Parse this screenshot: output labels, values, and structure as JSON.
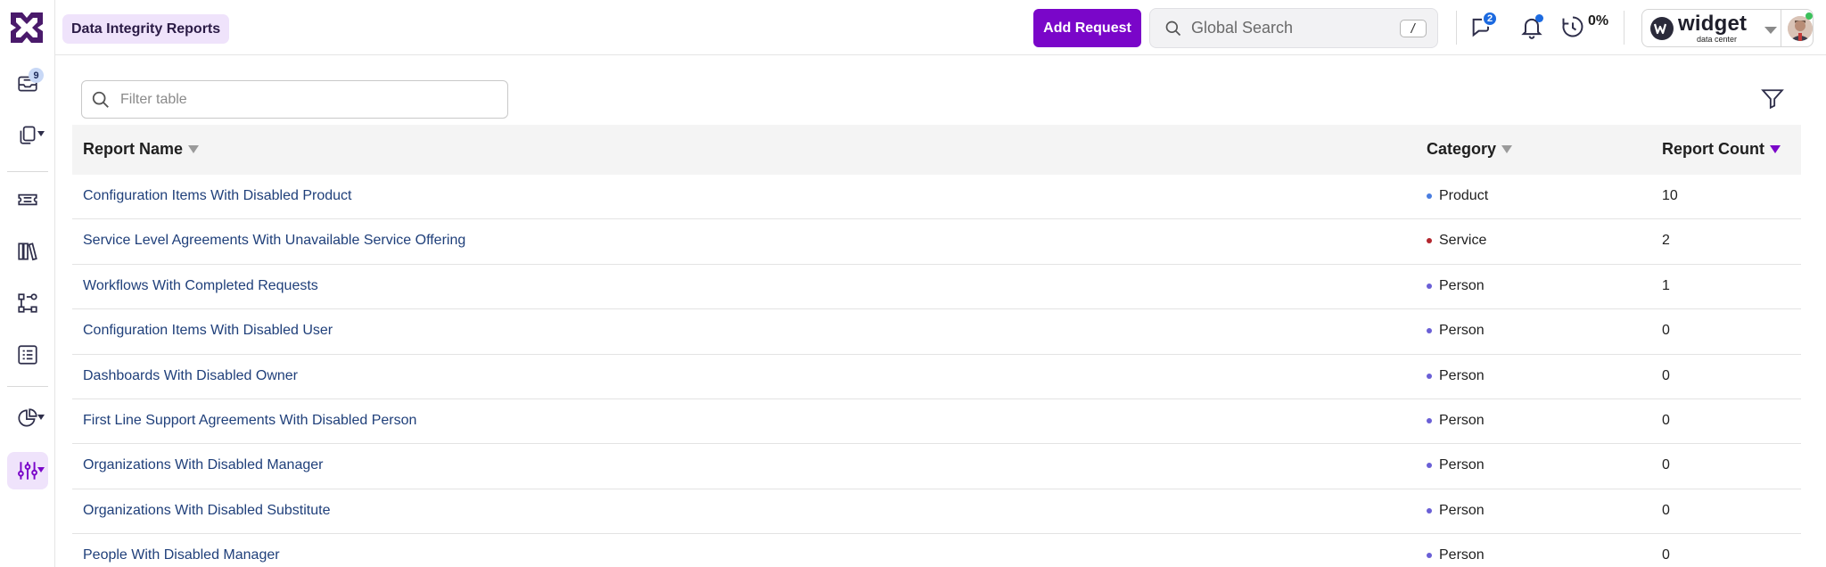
{
  "app": {
    "breadcrumb": "Data Integrity Reports"
  },
  "sidebar": {
    "inbox_badge": "9",
    "items": [
      {
        "name": "inbox-icon"
      },
      {
        "name": "copies-icon"
      },
      {
        "name": "ticket-icon"
      },
      {
        "name": "library-icon"
      },
      {
        "name": "workflow-icon"
      },
      {
        "name": "list-icon"
      },
      {
        "name": "analytics-icon"
      },
      {
        "name": "settings-sliders-icon"
      }
    ]
  },
  "header": {
    "add_request_label": "Add Request",
    "search_placeholder": "Global Search",
    "search_shortcut": "/",
    "chat_badge": "2",
    "timer_percent": "0%",
    "account": {
      "brand": "widget",
      "brand_sub": "data center"
    }
  },
  "main": {
    "filter_placeholder": "Filter table",
    "columns": {
      "name": "Report Name",
      "category": "Category",
      "count": "Report Count"
    },
    "rows": [
      {
        "name": "Configuration Items With Disabled Product",
        "category": "Product",
        "dot": "#4a7de0",
        "count": "10"
      },
      {
        "name": "Service Level Agreements With Unavailable Service Offering",
        "category": "Service",
        "dot": "#b3262e",
        "count": "2"
      },
      {
        "name": "Workflows With Completed Requests",
        "category": "Person",
        "dot": "#6a5fd6",
        "count": "1"
      },
      {
        "name": "Configuration Items With Disabled User",
        "category": "Person",
        "dot": "#6a5fd6",
        "count": "0"
      },
      {
        "name": "Dashboards With Disabled Owner",
        "category": "Person",
        "dot": "#6a5fd6",
        "count": "0"
      },
      {
        "name": "First Line Support Agreements With Disabled Person",
        "category": "Person",
        "dot": "#6a5fd6",
        "count": "0"
      },
      {
        "name": "Organizations With Disabled Manager",
        "category": "Person",
        "dot": "#6a5fd6",
        "count": "0"
      },
      {
        "name": "Organizations With Disabled Substitute",
        "category": "Person",
        "dot": "#6a5fd6",
        "count": "0"
      },
      {
        "name": "People With Disabled Manager",
        "category": "Person",
        "dot": "#6a5fd6",
        "count": "0"
      }
    ]
  },
  "colors": {
    "accent": "#7a06c9",
    "link": "#1f3f7a"
  }
}
